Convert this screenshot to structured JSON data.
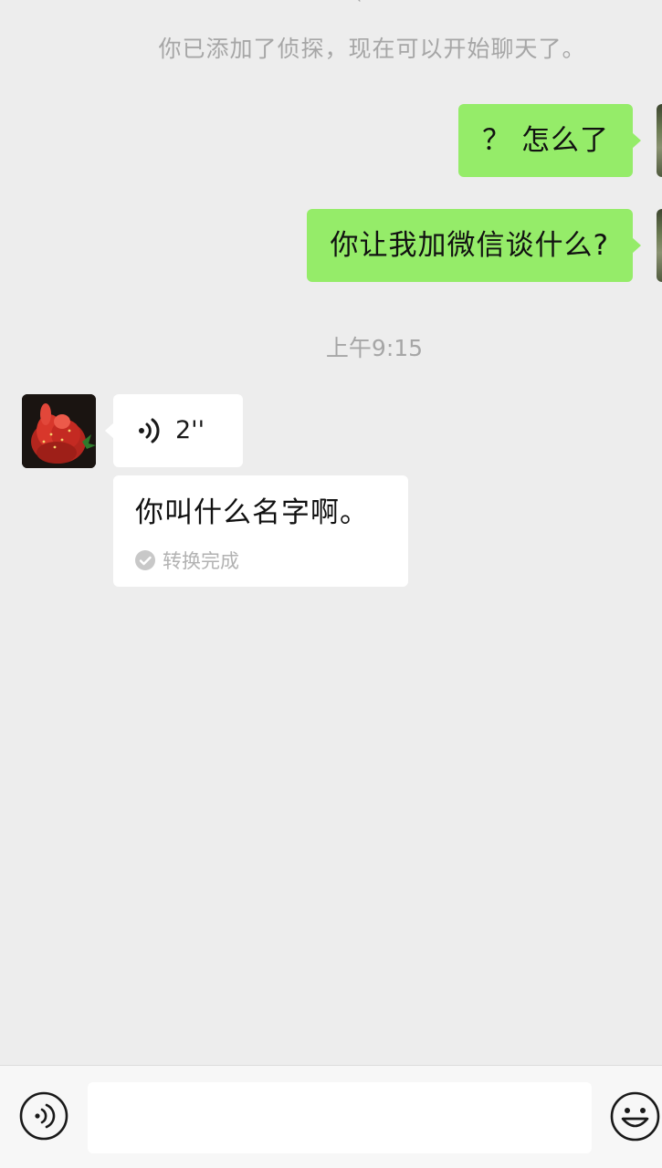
{
  "chat": {
    "system_notice": "你已添加了侦探，现在可以开始聊天了。",
    "timestamp": "上午9:15",
    "messages_out": [
      {
        "text": "？ 怎么了"
      },
      {
        "text": "你让我加微信谈什么?"
      }
    ],
    "voice_message": {
      "duration": "2''",
      "transcript": "你叫什么名字啊。",
      "status": "转换完成"
    }
  },
  "input_bar": {
    "placeholder": "",
    "voice_icon": "voice-icon",
    "emoji_icon": "smiley-face-icon"
  },
  "colors": {
    "background": "#ededed",
    "bubble_out": "#95ec69",
    "bubble_in": "#ffffff",
    "meta_text": "#a6a6a6"
  }
}
